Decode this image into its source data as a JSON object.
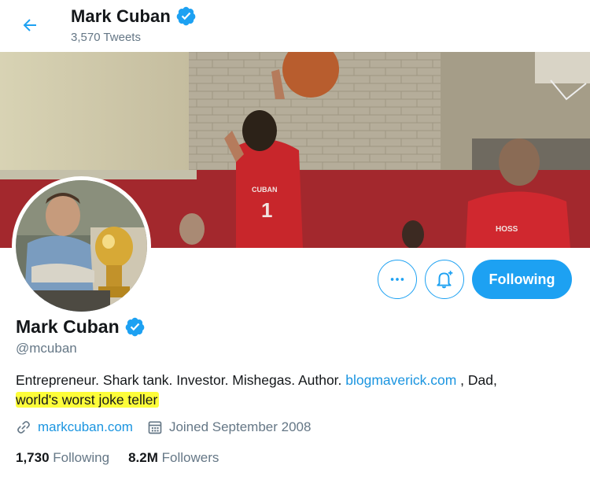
{
  "header": {
    "title": "Mark Cuban",
    "tweet_count": "3,570 Tweets"
  },
  "profile": {
    "name": "Mark Cuban",
    "handle": "@mcuban",
    "bio": {
      "part1": "Entrepreneur. Shark tank. Investor. Mishegas. Author. ",
      "link": "blogmaverick.com",
      "part2": " , Dad,",
      "highlighted": "world's worst joke teller"
    },
    "website": "markcuban.com",
    "joined": "Joined September 2008",
    "following_count": "1,730",
    "following_label": "Following",
    "followers_count": "8.2M",
    "followers_label": "Followers"
  },
  "actions": {
    "follow_label": "Following"
  },
  "banner": {
    "jersey_front": "CUBAN",
    "jersey_front_number": "1",
    "jersey_back": "HOSS"
  },
  "icons": {
    "back": "arrow-left-icon",
    "verified": "verified-badge-icon",
    "more": "more-dots-icon",
    "notify": "bell-plus-icon",
    "link": "link-icon",
    "calendar": "calendar-icon"
  },
  "colors": {
    "accent": "#1da1f2",
    "link": "#1b95e0",
    "secondary_text": "#657786",
    "highlight": "#fdfd3a"
  }
}
